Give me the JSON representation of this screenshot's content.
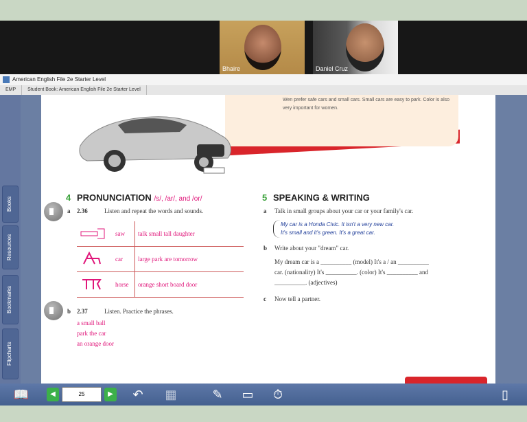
{
  "video_call": {
    "participants": [
      {
        "name": "Bhaire"
      },
      {
        "name": "Daniel Cruz"
      }
    ]
  },
  "window": {
    "title": "American English File 2e Starter Level"
  },
  "tabs": [
    {
      "label": "EMP"
    },
    {
      "label": "Student Book: American English File 2e Starter Level"
    }
  ],
  "sidebar": {
    "items": [
      {
        "label": "Books"
      },
      {
        "label": "Resources"
      },
      {
        "label": "Bookmarks"
      },
      {
        "label": "Flipcharts"
      }
    ]
  },
  "book_page": {
    "info_box_text": "Wen prefer safe cars and small cars. Small cars are easy to park. Color is also very important for women.",
    "pronunciation": {
      "number": "4",
      "title": "PRONUNCIATION",
      "sounds": "/s/, /ar/, and /or/",
      "part_a": "a",
      "audio_a": "2.36",
      "instruction_a": "Listen and repeat the words and sounds.",
      "rows": [
        {
          "key": "saw",
          "words": "talk   small   tall   daughter"
        },
        {
          "key": "car",
          "words": "large   park   are   tomorrow"
        },
        {
          "key": "horse",
          "words": "orange   short   board   door"
        }
      ],
      "part_b": "b",
      "audio_b": "2.37",
      "instruction_b": "Listen. Practice the phrases.",
      "phrases": [
        "a small ball",
        "park the car",
        "an orange door"
      ]
    },
    "speaking": {
      "number": "5",
      "title": "SPEAKING & WRITING",
      "a_letter": "a",
      "a_text": "Talk in small groups about your car or your family's car.",
      "bubble_line1": "My car is a Honda Civic. It isn't a very new car.",
      "bubble_line2": "It's small and it's green. It's a great car.",
      "b_letter": "b",
      "b_text": "Write about your \"dream\" car.",
      "b_line1": "My dream car is a __________ (model) It's a / an __________",
      "b_line2": "car. (nationality) It's __________. (color) It's __________ and",
      "b_line3": "__________. (adjectives)",
      "c_letter": "c",
      "c_text": "Now tell a partner."
    }
  },
  "toolbar": {
    "page_number": "25"
  },
  "colors": {
    "accent": "#e0167a",
    "section_green": "#3aa13a",
    "toolbar": "#4f6794"
  }
}
